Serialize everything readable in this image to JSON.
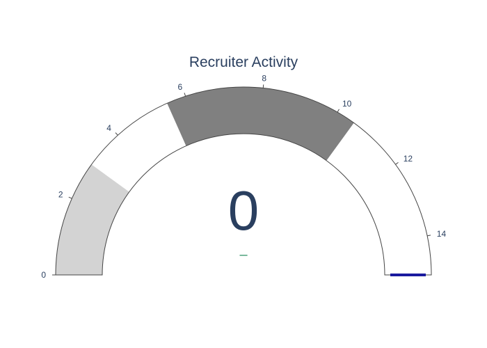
{
  "chart_data": {
    "type": "gauge",
    "title": "Recruiter Activity",
    "value": 0,
    "value_label": "0",
    "delta_label": "–",
    "range": [
      0,
      15
    ],
    "ticks": [
      0,
      2,
      4,
      6,
      8,
      10,
      12,
      14
    ],
    "tick_labels": [
      "0",
      "2",
      "4",
      "6",
      "8",
      "10",
      "12",
      "14"
    ],
    "steps": [
      {
        "range": [
          0,
          3
        ],
        "color": "#d3d3d3"
      },
      {
        "range": [
          3,
          5.5
        ],
        "color": "#ffffff"
      },
      {
        "range": [
          5.5,
          10.5
        ],
        "color": "#808080"
      },
      {
        "range": [
          10.5,
          15
        ],
        "color": "#ffffff"
      }
    ],
    "threshold": {
      "value": 15,
      "color": "#1a1a9e"
    },
    "colors": {
      "text": "#2a3f5f",
      "delta": "#3d9970",
      "outline": "#444444"
    }
  }
}
